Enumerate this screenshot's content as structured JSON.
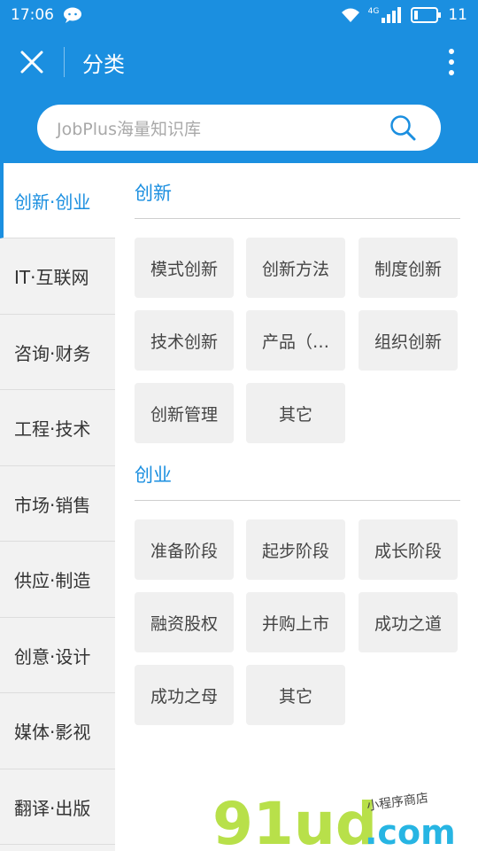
{
  "status": {
    "time": "17:06",
    "network": "4G",
    "battery": "11"
  },
  "header": {
    "title": "分类"
  },
  "search": {
    "placeholder": "JobPlus海量知识库"
  },
  "sidebar": {
    "items": [
      {
        "label": "创新·创业",
        "active": true
      },
      {
        "label": "IT·互联网"
      },
      {
        "label": "咨询·财务"
      },
      {
        "label": "工程·技术"
      },
      {
        "label": "市场·销售"
      },
      {
        "label": "供应·制造"
      },
      {
        "label": "创意·设计"
      },
      {
        "label": "媒体·影视"
      },
      {
        "label": "翻译·出版"
      }
    ]
  },
  "sections": [
    {
      "title": "创新",
      "tags": [
        "模式创新",
        "创新方法",
        "制度创新",
        "技术创新",
        "产品（…",
        "组织创新",
        "创新管理",
        "其它"
      ]
    },
    {
      "title": "创业",
      "tags": [
        "准备阶段",
        "起步阶段",
        "成长阶段",
        "融资股权",
        "并购上市",
        "成功之道",
        "成功之母",
        "其它"
      ]
    }
  ],
  "watermark": {
    "logo": "91ud",
    "domain": ".com",
    "slogan": "小程序商店"
  },
  "colors": {
    "brand": "#1b8fe0",
    "tag_bg": "#f0f0f0",
    "sidebar_bg": "#f2f2f2"
  }
}
